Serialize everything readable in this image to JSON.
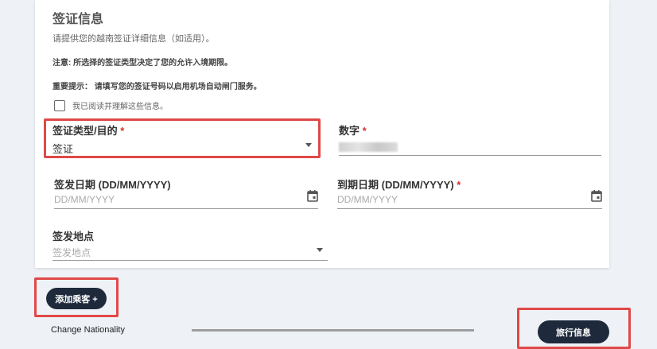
{
  "section": {
    "title": "签证信息",
    "description": "请提供您的越南签证详细信息（如适用）。",
    "note_1": "注意: 所选择的签证类型决定了您的允许入境期限。",
    "note_2": "重要提示： 请填写您的签证号码以启用机场自动闸门服务。",
    "confirm_checkbox_label": "我已阅读并理解这些信息。",
    "confirm_checked": false
  },
  "fields": {
    "visa_type": {
      "label": "签证类型/目的",
      "required_mark": "*",
      "value": "签证"
    },
    "number": {
      "label": "数字",
      "required_mark": "*"
    },
    "issue_date": {
      "label": "签发日期 (DD/MM/YYYY)",
      "placeholder": "DD/MM/YYYY"
    },
    "expiry_date": {
      "label": "到期日期 (DD/MM/YYYY)",
      "required_mark": "*",
      "placeholder": "DD/MM/YYYY"
    },
    "issue_place": {
      "label": "签发地点",
      "placeholder": "签发地点"
    }
  },
  "actions": {
    "add_passenger": "添加乘客 +",
    "change_nationality": "Change Nationality",
    "travel_info": "旅行信息"
  },
  "progress": {
    "fraction": 1.0
  },
  "colors": {
    "button_dark": "#1e2a3c",
    "required": "#d32f2f",
    "highlight": "#e04848",
    "background": "#eef1f6"
  },
  "icons": [
    "dropdown-arrow-icon",
    "calendar-icon",
    "checkbox-icon"
  ]
}
